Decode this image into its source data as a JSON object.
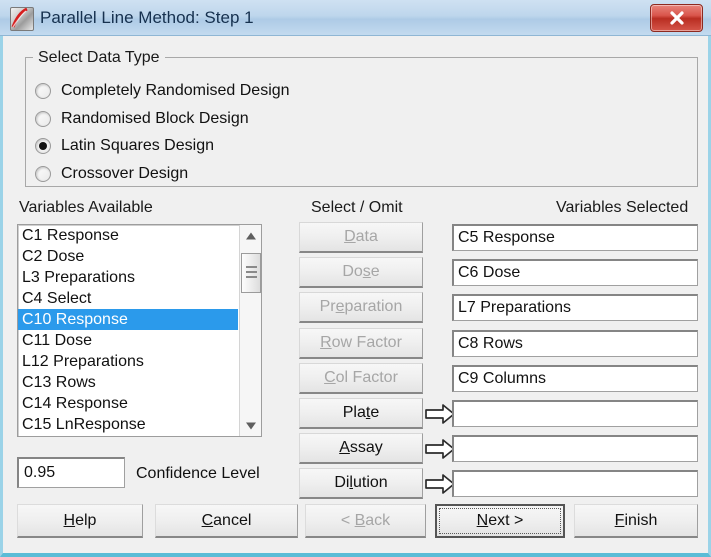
{
  "window": {
    "title": "Parallel Line Method: Step 1",
    "icon": "app-icon",
    "close_label": "Close",
    "accent_border": "#5bbcd6",
    "titlebar_color": "#bed6ec",
    "close_color": "#b92e22"
  },
  "group": {
    "legend": "Select Data Type",
    "options": [
      {
        "label": "Completely Randomised Design",
        "selected": false
      },
      {
        "label": "Randomised Block Design",
        "selected": false
      },
      {
        "label": "Latin Squares Design",
        "selected": true
      },
      {
        "label": "Crossover Design",
        "selected": false
      }
    ]
  },
  "columns": {
    "available_header": "Variables Available",
    "middle_header": "Select / Omit",
    "selected_header": "Variables Selected"
  },
  "available_list": {
    "items": [
      {
        "label": "C1 Response",
        "selected": false
      },
      {
        "label": "C2 Dose",
        "selected": false
      },
      {
        "label": "L3 Preparations",
        "selected": false
      },
      {
        "label": "C4 Select",
        "selected": false
      },
      {
        "label": "C10 Response",
        "selected": true
      },
      {
        "label": "C11 Dose",
        "selected": false
      },
      {
        "label": "L12 Preparations",
        "selected": false
      },
      {
        "label": "C13 Rows",
        "selected": false
      },
      {
        "label": "C14 Response",
        "selected": false
      },
      {
        "label": "C15 LnResponse",
        "selected": false
      }
    ],
    "selection_color": "#2b9aeb",
    "scroll_up_icon": "scroll-up-arrow-icon",
    "scroll_down_icon": "scroll-down-arrow-icon",
    "thumb_icon": "scrollbar-thumb"
  },
  "transfer_rows": [
    {
      "button": "Data",
      "mnemonic": "D",
      "enabled": false,
      "arrow": false,
      "field": "C5 Response"
    },
    {
      "button": "Dose",
      "mnemonic": "s",
      "enabled": false,
      "arrow": false,
      "field": "C6 Dose"
    },
    {
      "button": "Preparation",
      "mnemonic": "e",
      "enabled": false,
      "arrow": false,
      "field": "L7 Preparations"
    },
    {
      "button": "Row Factor",
      "mnemonic": "R",
      "enabled": false,
      "arrow": false,
      "field": "C8 Rows"
    },
    {
      "button": "Col Factor",
      "mnemonic": "C",
      "enabled": false,
      "arrow": false,
      "field": "C9 Columns"
    },
    {
      "button": "Plate",
      "mnemonic": "t",
      "enabled": true,
      "arrow": true,
      "field": ""
    },
    {
      "button": "Assay",
      "mnemonic": "A",
      "enabled": true,
      "arrow": true,
      "field": ""
    },
    {
      "button": "Dilution",
      "mnemonic": "l",
      "enabled": true,
      "arrow": true,
      "field": ""
    }
  ],
  "confidence": {
    "value": "0.95",
    "label": "Confidence Level"
  },
  "actions": {
    "help": {
      "label": "Help",
      "mnemonic": "H",
      "enabled": true,
      "default": false
    },
    "cancel": {
      "label": "Cancel",
      "mnemonic": "C",
      "enabled": true,
      "default": false
    },
    "back": {
      "label": "< Back",
      "mnemonic": "B",
      "enabled": false,
      "default": false
    },
    "next": {
      "label": "Next >",
      "mnemonic": "N",
      "enabled": true,
      "default": true
    },
    "finish": {
      "label": "Finish",
      "mnemonic": "F",
      "enabled": true,
      "default": false
    }
  }
}
